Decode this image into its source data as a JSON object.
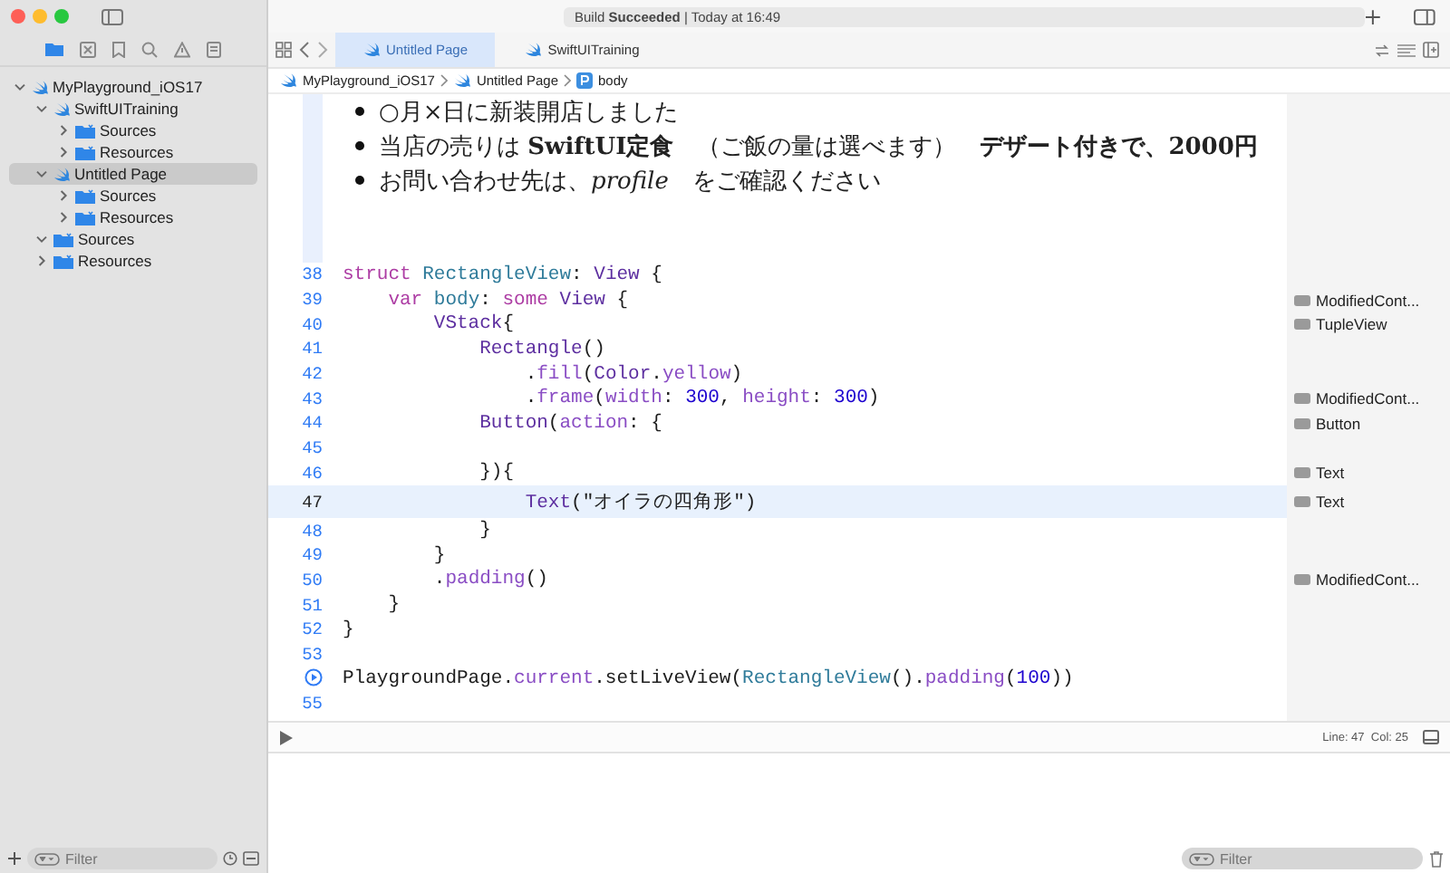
{
  "build_status": "Build **Succeeded** | Today at 16:49",
  "navigator": [
    {
      "label": "MyPlayground_iOS17",
      "kind": "playground",
      "expanded": true,
      "selected": false,
      "children": [
        {
          "label": "SwiftUITraining",
          "kind": "playground",
          "expanded": true,
          "selected": false,
          "children": [
            {
              "label": "Sources",
              "kind": "folder",
              "expanded": false,
              "selected": false
            },
            {
              "label": "Resources",
              "kind": "folder",
              "expanded": false,
              "selected": false
            }
          ]
        },
        {
          "label": "Untitled Page",
          "kind": "playground",
          "expanded": true,
          "selected": true,
          "children": [
            {
              "label": "Sources",
              "kind": "folder",
              "expanded": false,
              "selected": false
            },
            {
              "label": "Resources",
              "kind": "folder",
              "expanded": false,
              "selected": false
            }
          ]
        },
        {
          "label": "Sources",
          "kind": "folder",
          "expanded": true,
          "selected": false
        },
        {
          "label": "Resources",
          "kind": "folder",
          "expanded": false,
          "selected": false
        }
      ]
    }
  ],
  "sidebar_filter": {
    "placeholder": "Filter"
  },
  "tabs": [
    {
      "label": "Untitled Page",
      "selected": true
    },
    {
      "label": "SwiftUITraining",
      "selected": false
    }
  ],
  "breadcrumb": [
    {
      "label": "MyPlayground_iOS17",
      "kind": "playground"
    },
    {
      "label": "Untitled Page",
      "kind": "playground"
    },
    {
      "label": "body",
      "kind": "property"
    }
  ],
  "doc_bullets": [
    "○月×日に新装開店しました",
    "当店の売りは **SwiftUI定食**　（ご飯の量は選べます）　**デザート付きで、2000円**",
    "お問い合わせ先は、*profile*　をご確認ください"
  ],
  "code_lines": [
    {
      "number": "38",
      "selected": false,
      "tokens": [
        {
          "text": "struct ",
          "kind": "keyword"
        },
        {
          "text": "RectangleView",
          "kind": "declaration"
        },
        {
          "text": ": ",
          "kind": "plain"
        },
        {
          "text": "View",
          "kind": "type"
        },
        {
          "text": " {",
          "kind": "plain"
        }
      ]
    },
    {
      "number": "39",
      "selected": false,
      "result": "ModifiedCont...",
      "tokens": [
        {
          "text": "    var ",
          "kind": "keyword"
        },
        {
          "text": "body",
          "kind": "declaration"
        },
        {
          "text": ": ",
          "kind": "plain"
        },
        {
          "text": "some ",
          "kind": "keyword"
        },
        {
          "text": "View",
          "kind": "type"
        },
        {
          "text": " {",
          "kind": "plain"
        }
      ]
    },
    {
      "number": "40",
      "selected": false,
      "result": "TupleView",
      "tokens": [
        {
          "text": "        VStack",
          "kind": "type"
        },
        {
          "text": "{",
          "kind": "plain"
        }
      ]
    },
    {
      "number": "41",
      "selected": false,
      "tokens": [
        {
          "text": "            Rectangle",
          "kind": "type"
        },
        {
          "text": "()",
          "kind": "plain"
        }
      ]
    },
    {
      "number": "42",
      "selected": false,
      "tokens": [
        {
          "text": "                .",
          "kind": "plain"
        },
        {
          "text": "fill",
          "kind": "member"
        },
        {
          "text": "(",
          "kind": "plain"
        },
        {
          "text": "Color",
          "kind": "type"
        },
        {
          "text": ".",
          "kind": "plain"
        },
        {
          "text": "yellow",
          "kind": "member"
        },
        {
          "text": ")",
          "kind": "plain"
        }
      ]
    },
    {
      "number": "43",
      "selected": false,
      "result": "ModifiedCont...",
      "tokens": [
        {
          "text": "                .",
          "kind": "plain"
        },
        {
          "text": "frame",
          "kind": "member"
        },
        {
          "text": "(",
          "kind": "plain"
        },
        {
          "text": "width",
          "kind": "member"
        },
        {
          "text": ": ",
          "kind": "plain"
        },
        {
          "text": "300",
          "kind": "number"
        },
        {
          "text": ", ",
          "kind": "plain"
        },
        {
          "text": "height",
          "kind": "member"
        },
        {
          "text": ": ",
          "kind": "plain"
        },
        {
          "text": "300",
          "kind": "number"
        },
        {
          "text": ")",
          "kind": "plain"
        }
      ]
    },
    {
      "number": "44",
      "selected": false,
      "result": "Button",
      "tokens": [
        {
          "text": "            Button",
          "kind": "type"
        },
        {
          "text": "(",
          "kind": "plain"
        },
        {
          "text": "action",
          "kind": "member"
        },
        {
          "text": ": {",
          "kind": "plain"
        }
      ]
    },
    {
      "number": "45",
      "selected": false
    },
    {
      "number": "46",
      "selected": false,
      "result": "Text",
      "tokens": [
        {
          "text": "            }){",
          "kind": "plain"
        }
      ]
    },
    {
      "number": "47",
      "selected": true,
      "result": "Text",
      "tokens": [
        {
          "text": "                Text",
          "kind": "type"
        },
        {
          "text": "(\"オイラの四角形\")",
          "kind": "plain"
        }
      ]
    },
    {
      "number": "48",
      "selected": false,
      "tokens": [
        {
          "text": "            }",
          "kind": "plain"
        }
      ]
    },
    {
      "number": "49",
      "selected": false,
      "tokens": [
        {
          "text": "        }",
          "kind": "plain"
        }
      ]
    },
    {
      "number": "50",
      "selected": false,
      "result": "ModifiedCont...",
      "tokens": [
        {
          "text": "        .",
          "kind": "plain"
        },
        {
          "text": "padding",
          "kind": "member"
        },
        {
          "text": "()",
          "kind": "plain"
        }
      ]
    },
    {
      "number": "51",
      "selected": false,
      "tokens": [
        {
          "text": "    }",
          "kind": "plain"
        }
      ]
    },
    {
      "number": "52",
      "selected": false,
      "tokens": [
        {
          "text": "}",
          "kind": "plain"
        }
      ]
    },
    {
      "number": "53",
      "selected": false
    },
    {
      "kind": "run",
      "selected": false,
      "tokens": [
        {
          "text": "PlaygroundPage.",
          "kind": "plain"
        },
        {
          "text": "current",
          "kind": "member"
        },
        {
          "text": ".setLiveView(",
          "kind": "plain"
        },
        {
          "text": "RectangleView",
          "kind": "declaration"
        },
        {
          "text": "().",
          "kind": "plain"
        },
        {
          "text": "padding",
          "kind": "member"
        },
        {
          "text": "(",
          "kind": "plain"
        },
        {
          "text": "100",
          "kind": "number"
        },
        {
          "text": "))",
          "kind": "plain"
        }
      ]
    },
    {
      "number": "55",
      "selected": false
    }
  ],
  "cursor_position": "Line: 47  Col: 25",
  "console_filter": {
    "placeholder": "Filter"
  }
}
